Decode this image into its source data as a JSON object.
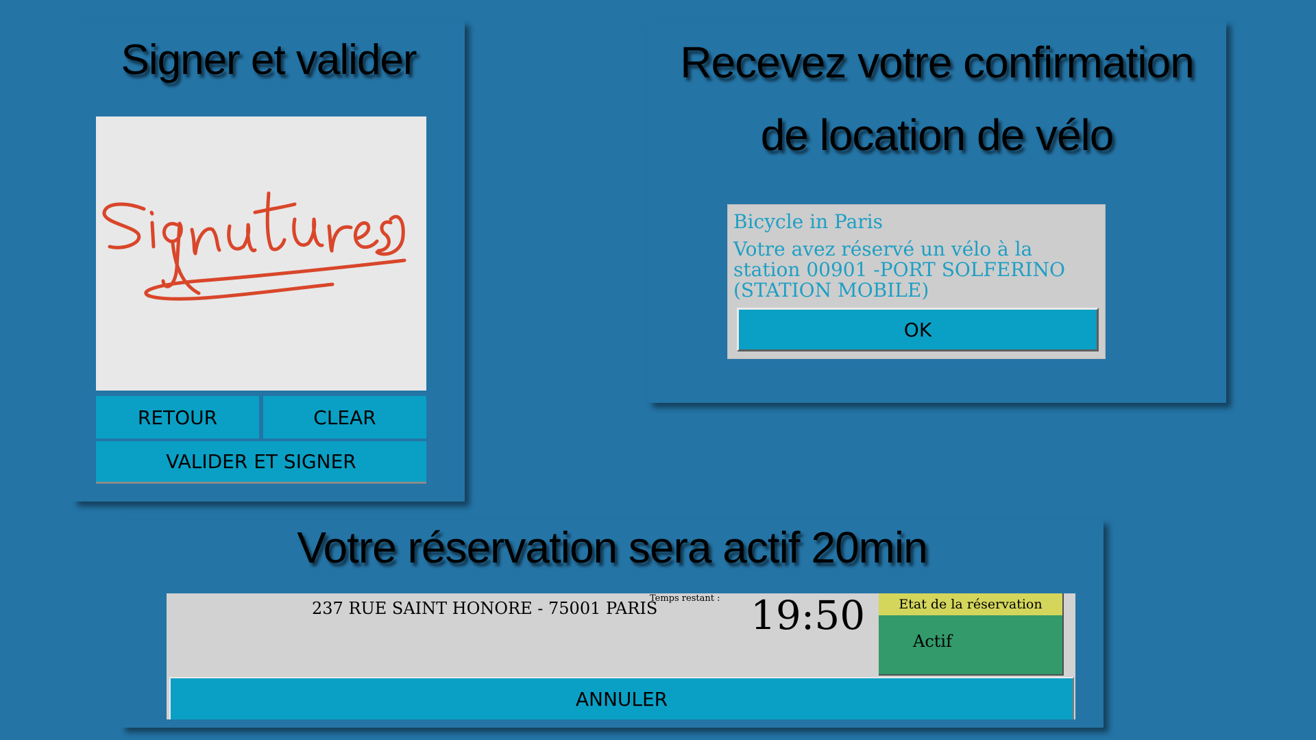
{
  "signature_panel": {
    "title": "Signer et valider",
    "buttons": {
      "back": "RETOUR",
      "clear": "CLEAR",
      "validate": "VALIDER ET SIGNER"
    },
    "signature_color": "#d9462a"
  },
  "confirmation_panel": {
    "title_line1": "Recevez votre confirmation",
    "title_line2": "de location de vélo",
    "dialog": {
      "title": "Bicycle in Paris",
      "message": "Votre avez réservé un vélo à la station 00901 -PORT SOLFERINO (STATION MOBILE)",
      "ok_label": "OK"
    }
  },
  "reservation_panel": {
    "title": "Votre réservation sera actif 20min",
    "address": "237 RUE SAINT HONORE - 75001 PARIS",
    "time_label": "Temps restant :",
    "time_value": "19:50",
    "status_header": "Etat de la réservation",
    "status_value": "Actif",
    "cancel_label": "ANNULER"
  },
  "colors": {
    "background": "#2474a6",
    "button": "#0aa0c5",
    "dialog_text": "#1e9fc4",
    "status_header": "#d4d65c",
    "status_active": "#339a6b"
  }
}
